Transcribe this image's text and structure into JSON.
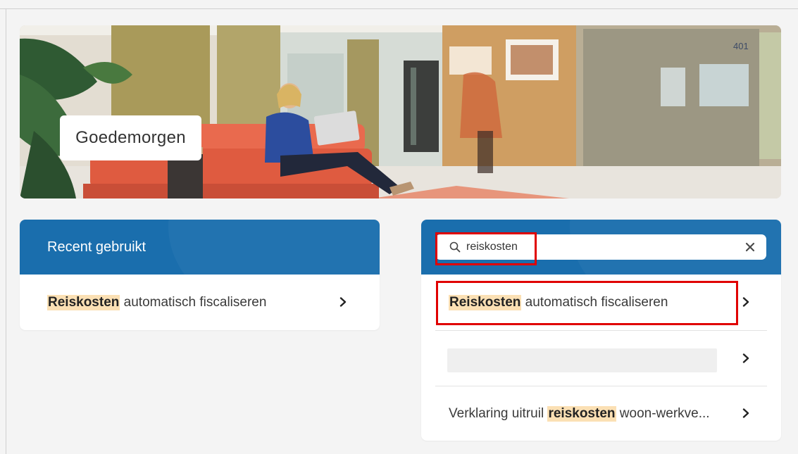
{
  "hero": {
    "greeting": "Goedemorgen",
    "room_number": "401"
  },
  "recent": {
    "title": "Recent gebruikt",
    "items": [
      {
        "highlight": "Reiskosten",
        "rest": " automatisch fiscaliseren"
      }
    ]
  },
  "search": {
    "value": "reiskosten",
    "results": [
      {
        "prefix": "",
        "highlight": "Reiskosten",
        "suffix": " automatisch fiscaliseren"
      },
      {
        "prefix": "",
        "highlight": "",
        "suffix": ""
      },
      {
        "prefix": "Verklaring uitruil ",
        "highlight": "reiskosten",
        "suffix": " woon-werkve..."
      }
    ]
  },
  "colors": {
    "header_blue": "#1a6ead",
    "highlight": "#fbe0b4",
    "annotation_red": "#e00000"
  },
  "icons": [
    "search-icon",
    "clear-icon",
    "chevron-right-icon"
  ]
}
